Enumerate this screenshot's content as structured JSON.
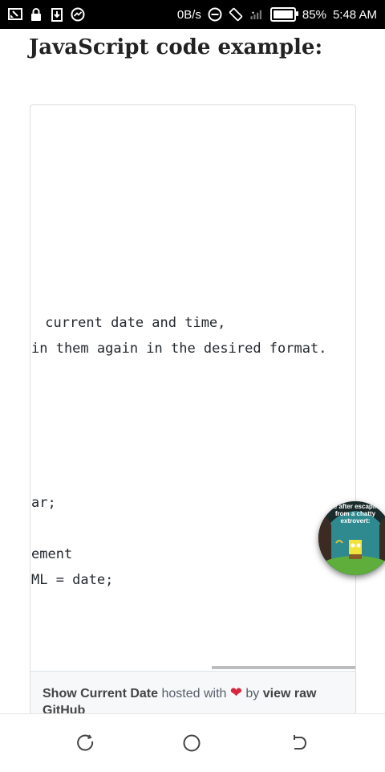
{
  "status_bar": {
    "network_speed": "0B/s",
    "battery_percent": "85%",
    "time": "5:48 AM",
    "left_icons": [
      "screen-cast-icon",
      "lock-icon",
      "download-icon",
      "messenger-icon"
    ],
    "right_icons": [
      "do-not-disturb-icon",
      "rotate-icon",
      "signal-icon",
      "battery-icon"
    ]
  },
  "page": {
    "title": "JavaScript code example:"
  },
  "gist": {
    "code_lines": [
      " current date and time,",
      "in them again in the desired format.",
      "ar;",
      "ement",
      "ML = date;"
    ],
    "footer": {
      "file_name": "Show Current Date",
      "hosted_with": "hosted with",
      "by": "by",
      "view_raw": "view raw",
      "host": "GitHub"
    }
  },
  "floating_bubble": {
    "caption": "Me after escaping from a chatty extrovert:"
  },
  "nav_bar": {
    "icons": [
      "recent-apps-icon",
      "home-icon",
      "back-icon"
    ]
  },
  "colors": {
    "status_bar_bg": "#000000",
    "heart": "#d7263d",
    "footer_bg": "#f6f8fa"
  }
}
